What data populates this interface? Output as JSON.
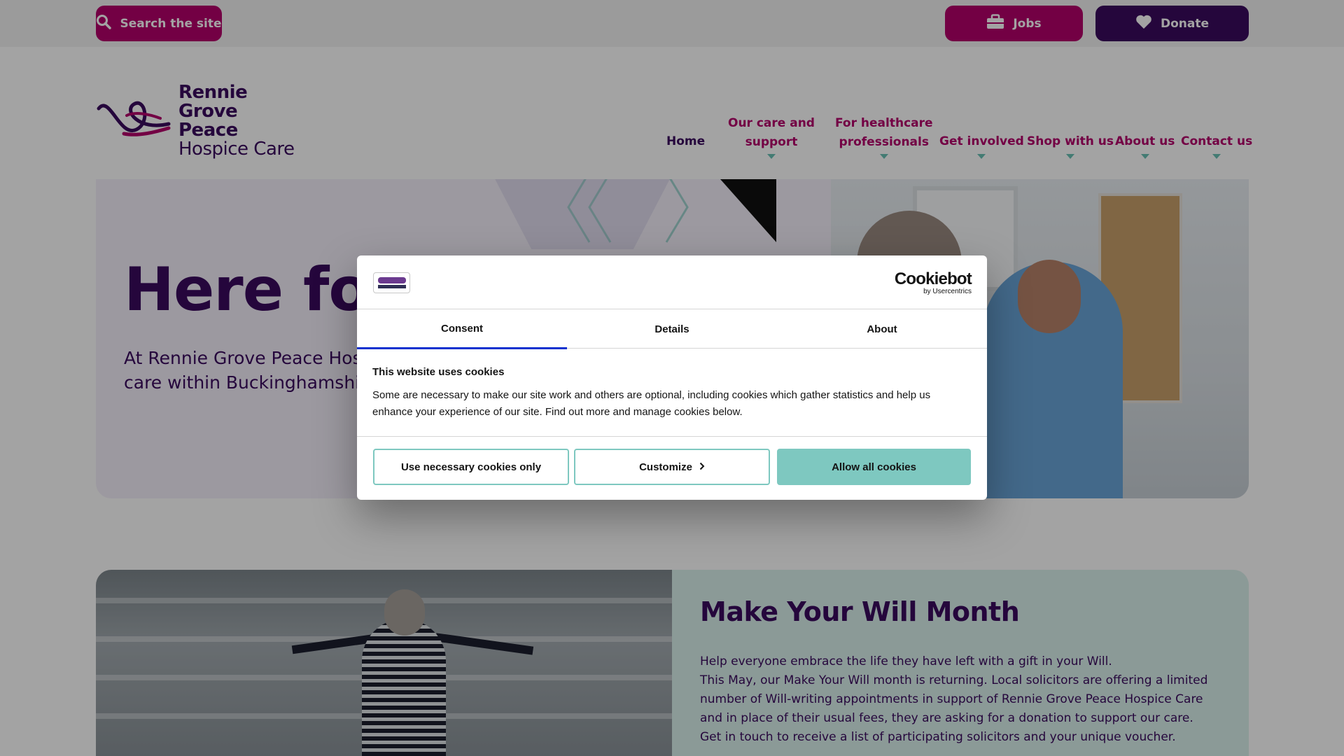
{
  "topbar": {
    "search_label": "Search the site",
    "jobs_label": "Jobs",
    "donate_label": "Donate",
    "icons": {
      "search": "search-icon",
      "jobs": "briefcase-icon",
      "donate": "heart-icon"
    }
  },
  "logo": {
    "line1": "Rennie",
    "line2": "Grove Peace",
    "line3": "Hospice Care"
  },
  "nav": {
    "home": "Home",
    "care_l1": "Our care and",
    "care_l2": "support",
    "health_l1": "For healthcare",
    "health_l2": "professionals",
    "involved": "Get involved",
    "shop": "Shop with us",
    "about": "About us",
    "contact": "Contact us"
  },
  "hero": {
    "title": "Here for",
    "text": "At Rennie Grove Peace Hospic patient-centred palliative care within Buckinghamshire and"
  },
  "feature": {
    "title": "Make Your Will Month",
    "para1": "Help everyone embrace the life they have left with a gift in your Will.",
    "para2": "This May, our Make Your Will month is returning. Local solicitors are offering a limited number of Will-writing appointments in support of Rennie Grove Peace Hospice Care and in place of their usual fees, they are asking for a donation to support our care. Get in touch to receive a list of participating solicitors and your unique voucher."
  },
  "cookie_dialog": {
    "brand": "Cookiebot",
    "brand_sub": "by Usercentrics",
    "tabs": [
      "Consent",
      "Details",
      "About"
    ],
    "active_tab": "Consent",
    "heading": "This website uses cookies",
    "body": "Some are necessary to make our site work and others are optional, including cookies which gather statistics and help us enhance your experience of our site.  Find out more and manage cookies below.",
    "buttons": {
      "necessary": "Use necessary cookies only",
      "customize": "Customize",
      "allow": "Allow all cookies"
    }
  },
  "colors": {
    "brand_purple": "#3b0a5e",
    "brand_magenta": "#b5006b",
    "accent_teal": "#7ec8c0",
    "tab_active": "#1032cf"
  }
}
